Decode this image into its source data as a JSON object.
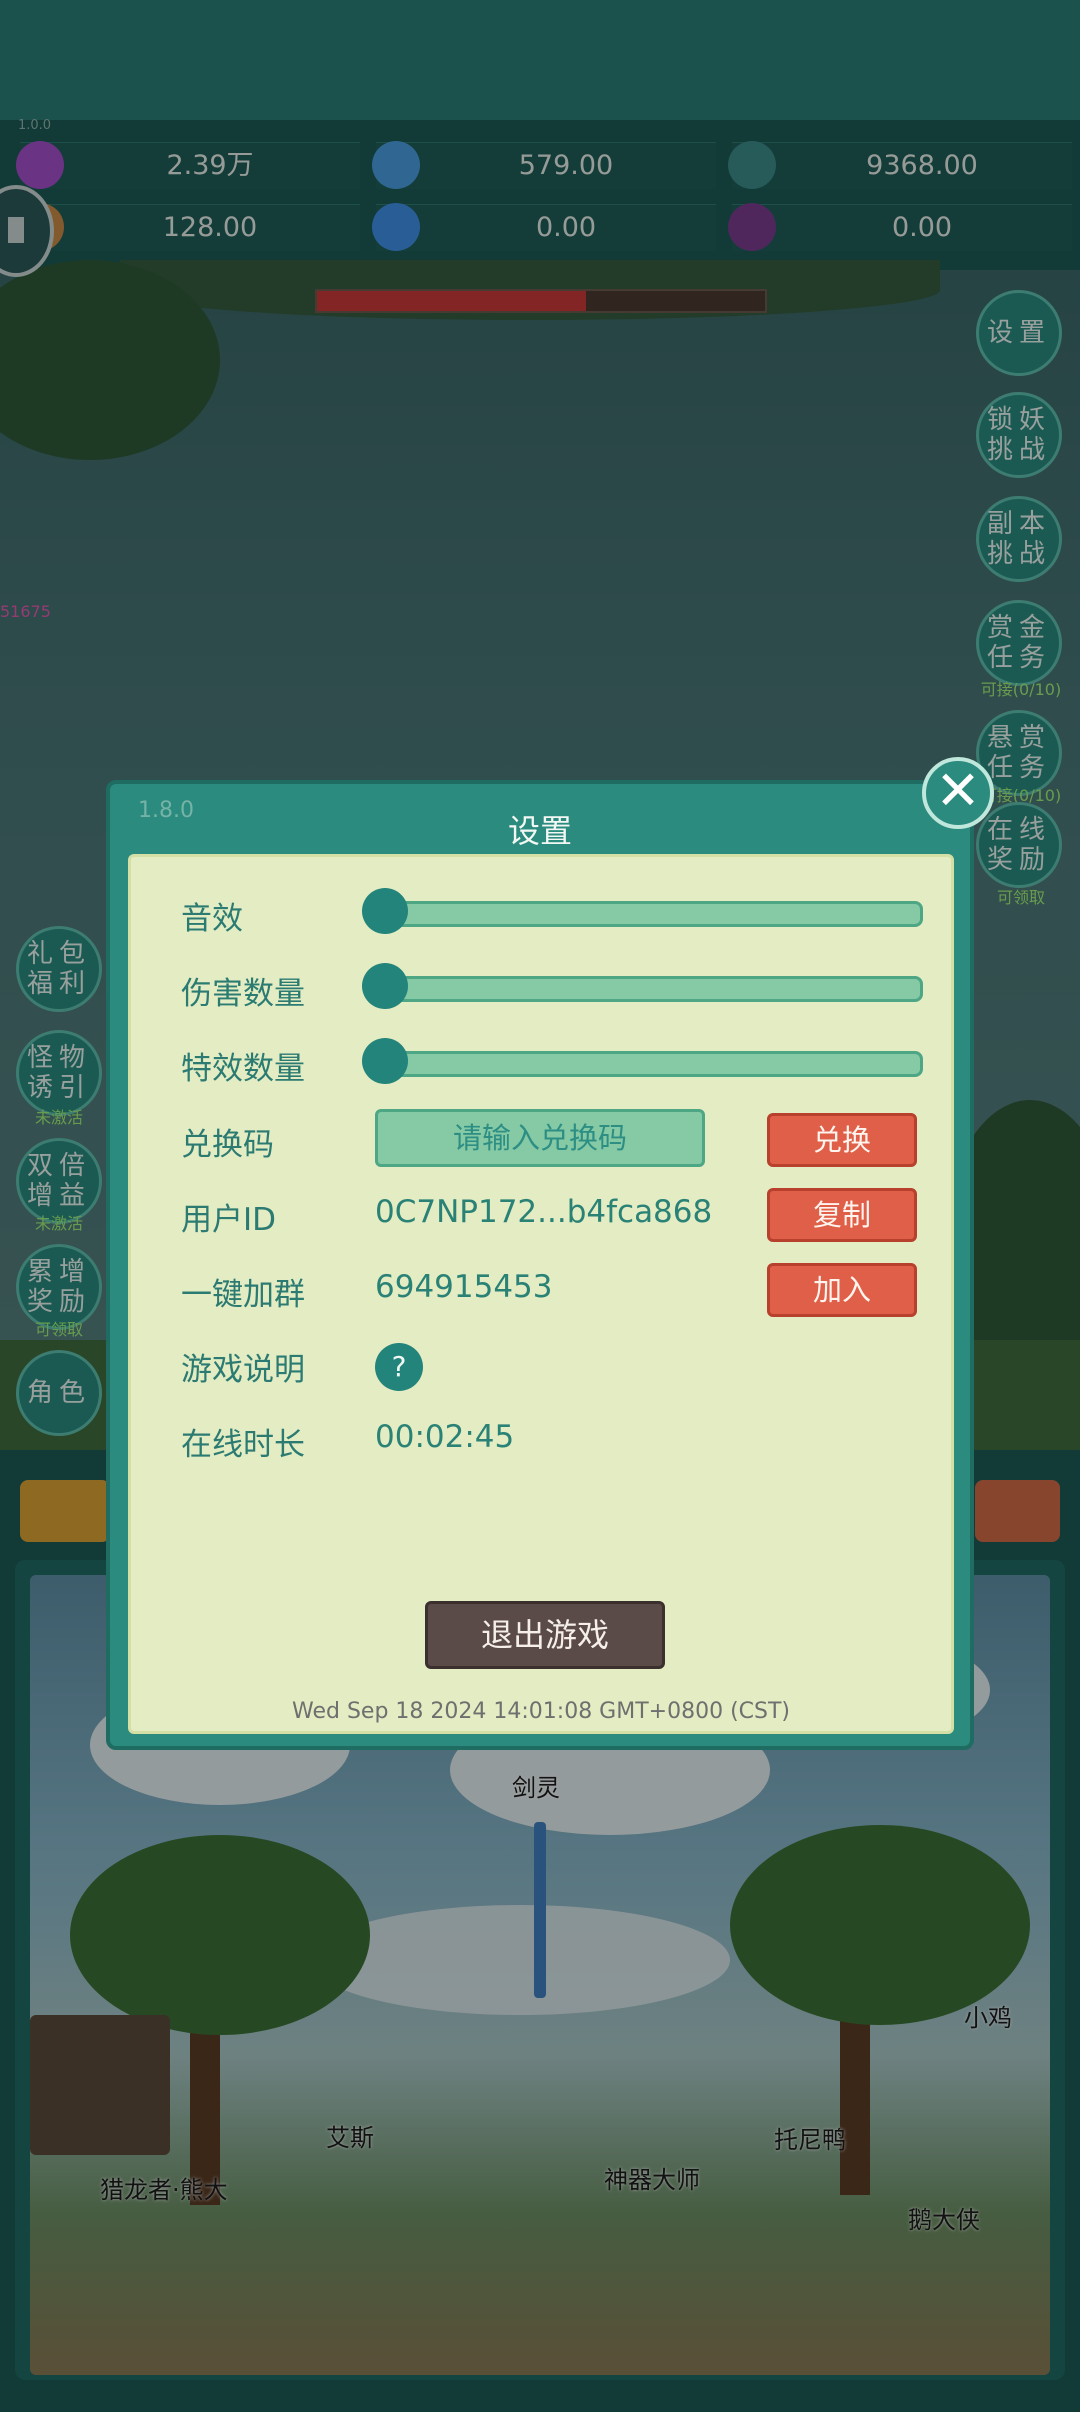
{
  "version_tiny": "1.0.0",
  "resources": [
    {
      "icon": "purple-gem-icon",
      "color": "#a54fc9",
      "value": "2.39万"
    },
    {
      "icon": "blue-crystal-icon",
      "color": "#4a9fe0",
      "value": "579.00"
    },
    {
      "icon": "teal-orb-icon",
      "color": "#3c8d8b",
      "value": "9368.00"
    },
    {
      "icon": "scroll-icon",
      "color": "#c98a45",
      "value": "128.00"
    },
    {
      "icon": "ice-crystal-icon",
      "color": "#3f8fe6",
      "value": "0.00"
    },
    {
      "icon": "purple-egg-icon",
      "color": "#7a3d8f",
      "value": "0.00"
    }
  ],
  "boss_hp_fraction": 0.6,
  "float_damage": "51675",
  "right_buttons": [
    {
      "label": "设置",
      "sub": ""
    },
    {
      "label": "锁妖挑战",
      "sub": ""
    },
    {
      "label": "副本挑战",
      "sub": ""
    },
    {
      "label": "赏金任务",
      "sub": "可接(0/10)"
    },
    {
      "label": "悬赏任务",
      "sub": "可接(0/10)"
    },
    {
      "label": "在线奖励",
      "sub": "可领取"
    }
  ],
  "left_buttons": [
    {
      "label": "礼包福利",
      "sub": ""
    },
    {
      "label": "怪物诱引",
      "sub": "未激活"
    },
    {
      "label": "双倍增益",
      "sub": "未激活"
    },
    {
      "label": "累增奖励",
      "sub": "可领取"
    },
    {
      "label": "角色",
      "sub": ""
    }
  ],
  "dialog": {
    "version": "1.8.0",
    "title": "设置",
    "sliders": [
      {
        "label": "音效",
        "value": 0
      },
      {
        "label": "伤害数量",
        "value": 0
      },
      {
        "label": "特效数量",
        "value": 0
      }
    ],
    "redeem": {
      "label": "兑换码",
      "placeholder": "请输入兑换码",
      "button": "兑换"
    },
    "user_id": {
      "label": "用户ID",
      "value": "0C7NP172...b4fca868",
      "button": "复制"
    },
    "group": {
      "label": "一键加群",
      "value": "694915453",
      "button": "加入"
    },
    "help": {
      "label": "游戏说明",
      "icon": "?"
    },
    "online": {
      "label": "在线时长",
      "value": "00:02:45"
    },
    "exit_button": "退出游戏",
    "timestamp": "Wed Sep 18 2024 14:01:08 GMT+0800 (CST)"
  },
  "characters": [
    {
      "name": "剑灵"
    },
    {
      "name": "小鸡"
    },
    {
      "name": "艾斯"
    },
    {
      "name": "托尼鸭"
    },
    {
      "name": "猎龙者·熊大"
    },
    {
      "name": "神器大师"
    },
    {
      "name": "鹅大侠"
    }
  ]
}
